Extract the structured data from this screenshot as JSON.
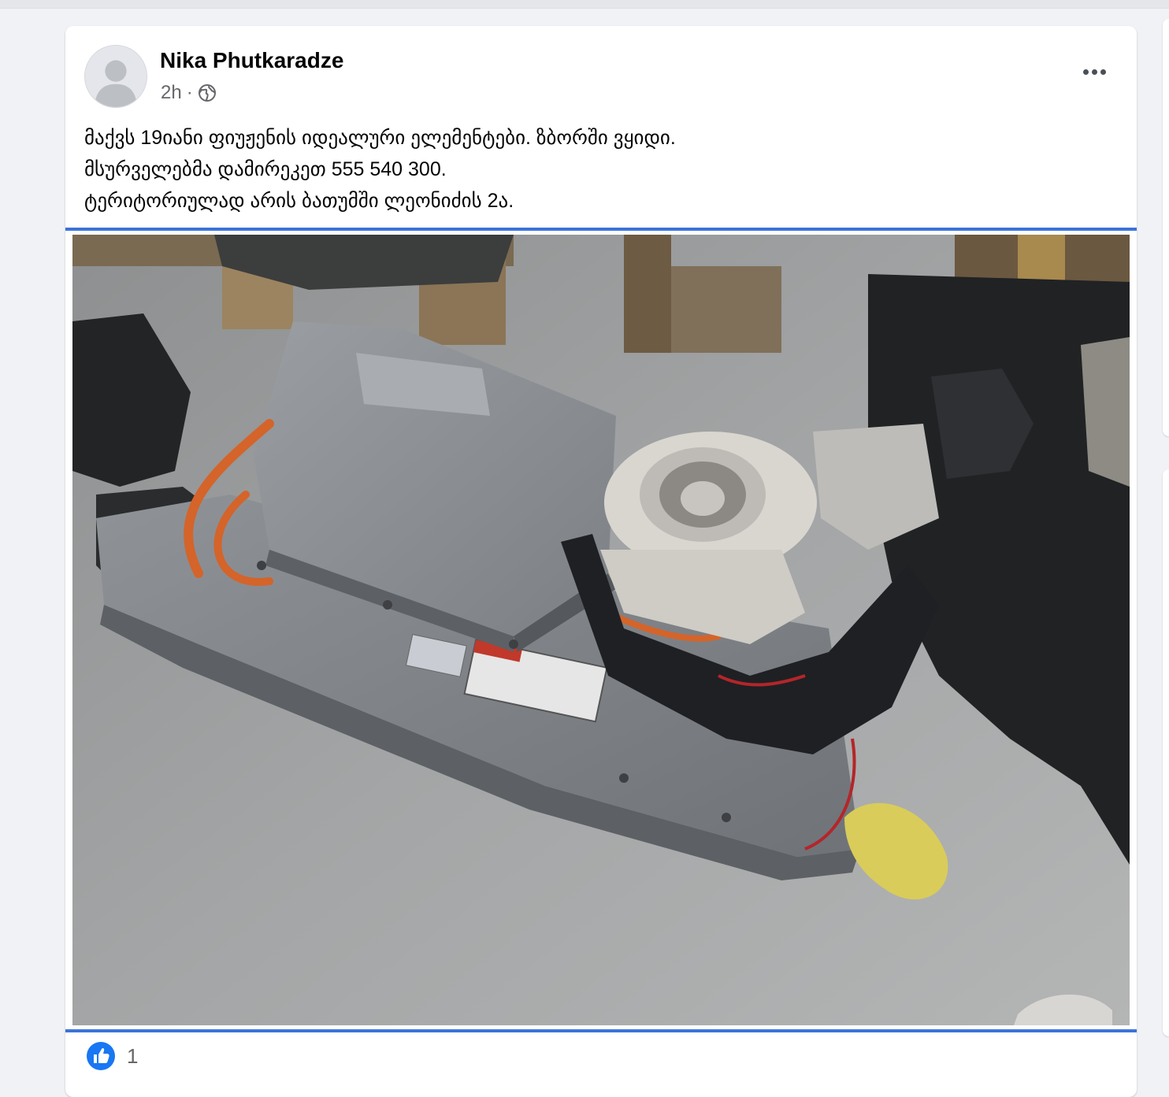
{
  "post": {
    "author": "Nika Phutkaradze",
    "time": "2h",
    "separator": "·",
    "audience_icon": "globe-icon",
    "more_icon": "more-horizontal-icon",
    "text_lines": [
      "მაქვს 19იანი ფიუჟენის იდეალური ელემენტები. ზბორში ვყიდი.",
      "მსურველებმა დამირეკეთ 555 540 300.",
      "ტერიტორიულად არის ბათუმში ლეონიძის 2ა."
    ],
    "photo_icon": "hybrid-battery-photo",
    "reactions": {
      "icon": "like-icon",
      "count": "1"
    }
  },
  "colors": {
    "page_background": "#f0f2f5",
    "card_background": "#ffffff",
    "secondary_text": "#65676b",
    "selection_border": "#3b73d9",
    "like_blue": "#1877f2"
  }
}
